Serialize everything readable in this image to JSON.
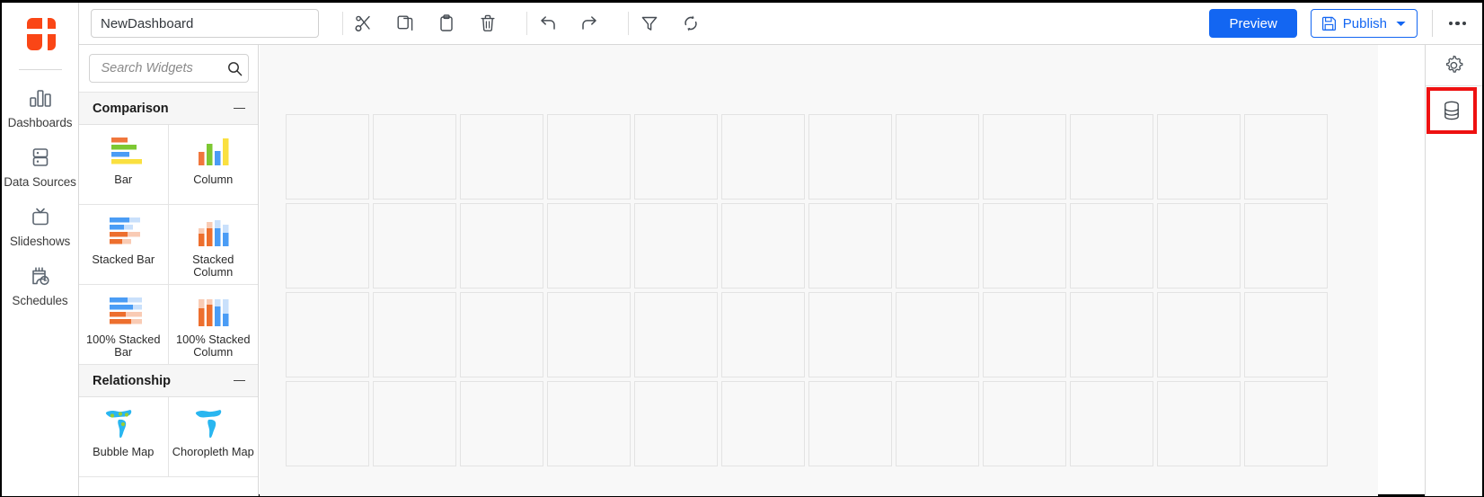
{
  "app": {
    "logo_color": "#fa4616",
    "accent_blue": "#1366f2",
    "highlight_color": "#ee1111",
    "canvas_bg": "#f8f8f8"
  },
  "left_rail": {
    "logo_name": "app-logo",
    "items": [
      {
        "label": "Dashboards",
        "icon": "bar-chart-icon"
      },
      {
        "label": "Data Sources",
        "icon": "database-rows-icon"
      },
      {
        "label": "Slideshows",
        "icon": "tv-icon"
      },
      {
        "label": "Schedules",
        "icon": "calendar-clock-icon"
      }
    ]
  },
  "toolbar": {
    "title_value": "NewDashboard",
    "title_placeholder": "Dashboard name",
    "actions": [
      {
        "name": "cut",
        "icon": "scissors-icon",
        "tooltip": "Cut"
      },
      {
        "name": "copy",
        "icon": "copy-icon",
        "tooltip": "Copy"
      },
      {
        "name": "paste",
        "icon": "clipboard-icon",
        "tooltip": "Paste"
      },
      {
        "name": "delete",
        "icon": "trash-icon",
        "tooltip": "Delete"
      }
    ],
    "history": [
      {
        "name": "undo",
        "icon": "undo-arrow-icon",
        "tooltip": "Undo"
      },
      {
        "name": "redo",
        "icon": "redo-arrow-icon",
        "tooltip": "Redo"
      }
    ],
    "data_actions": [
      {
        "name": "filter",
        "icon": "funnel-icon",
        "tooltip": "Filter"
      },
      {
        "name": "refresh",
        "icon": "refresh-icon",
        "tooltip": "Refresh"
      }
    ],
    "preview_label": "Preview",
    "publish_label": "Publish",
    "publish_icon": "save-disk-icon",
    "publish_caret": "chevron-down-icon",
    "more_label": "More options",
    "more_icon": "kebab-menu-icon"
  },
  "widget_panel": {
    "search_placeholder": "Search Widgets",
    "search_value": "",
    "search_icon": "search-icon",
    "sections": [
      {
        "title": "Comparison",
        "collapsed": false,
        "collapse_icon": "minus-icon",
        "widgets": [
          {
            "label": "Bar",
            "thumb": "bar-thumb"
          },
          {
            "label": "Column",
            "thumb": "column-thumb"
          },
          {
            "label": "Stacked Bar",
            "thumb": "stacked-bar-thumb"
          },
          {
            "label": "Stacked Column",
            "thumb": "stacked-column-thumb"
          },
          {
            "label": "100% Stacked Bar",
            "thumb": "pct-stacked-bar-thumb"
          },
          {
            "label": "100% Stacked Column",
            "thumb": "pct-stacked-column-thumb"
          }
        ]
      },
      {
        "title": "Relationship",
        "collapsed": false,
        "collapse_icon": "minus-icon",
        "widgets": [
          {
            "label": "Bubble Map",
            "thumb": "bubble-map-thumb"
          },
          {
            "label": "Choropleth Map",
            "thumb": "choropleth-map-thumb"
          }
        ]
      }
    ],
    "thumb_colors": {
      "orange": "#f0763c",
      "green": "#7dc832",
      "blue": "#4a9cf5",
      "yellow": "#fae040",
      "orange_dark": "#ed6f2e",
      "orange_light": "#f9cbb4",
      "blue_light": "#c9e0fb",
      "map_blue": "#29b6f0",
      "bubble_green": "#9acd32"
    }
  },
  "canvas": {
    "columns": 12,
    "rows": 4,
    "cell_label": "empty-grid-cell"
  },
  "right_rail": {
    "items": [
      {
        "name": "dashboard-settings",
        "icon": "gear-icon",
        "highlighted": false
      },
      {
        "name": "data-source-panel",
        "icon": "database-icon",
        "highlighted": true
      }
    ]
  }
}
